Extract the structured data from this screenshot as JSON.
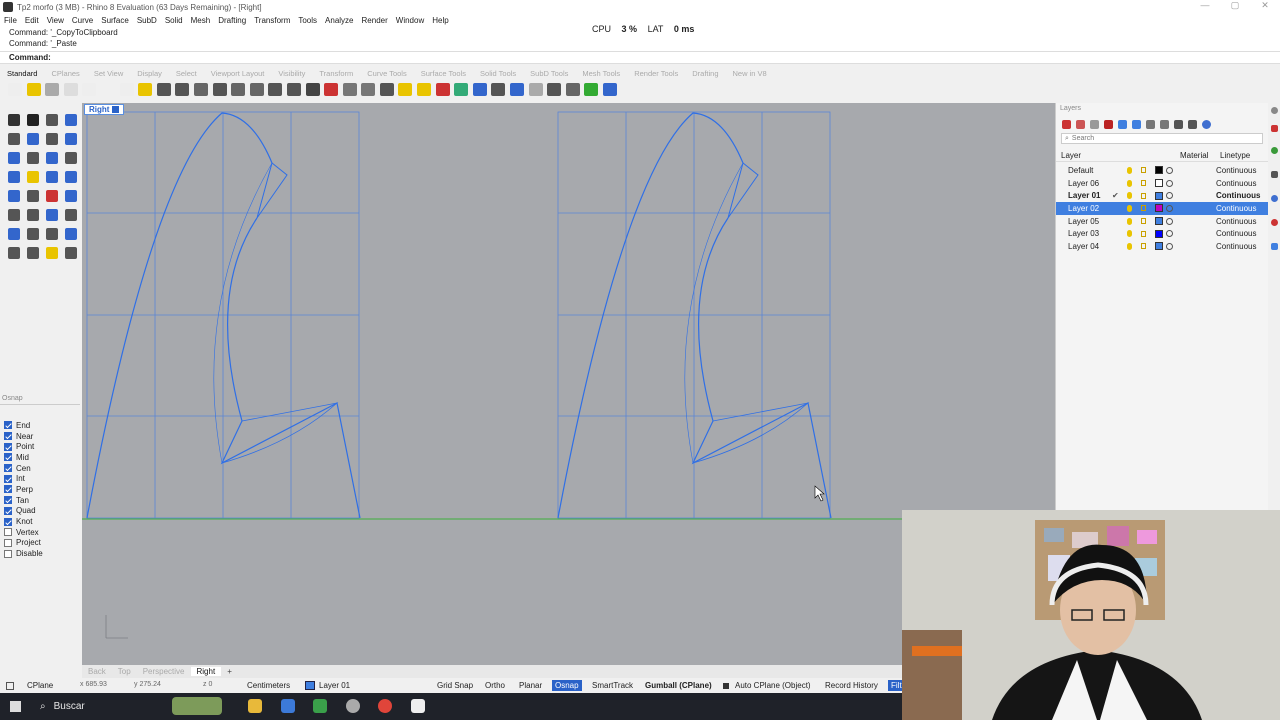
{
  "window": {
    "title": "Tp2 morfo (3 MB) - Rhino 8 Evaluation (63 Days Remaining) - [Right]"
  },
  "menu": [
    "File",
    "Edit",
    "View",
    "Curve",
    "Surface",
    "SubD",
    "Solid",
    "Mesh",
    "Drafting",
    "Transform",
    "Tools",
    "Analyze",
    "Render",
    "Window",
    "Help"
  ],
  "command_history": [
    "Command: '_CopyToClipboard",
    "Command: '_Paste"
  ],
  "perf": {
    "cpu_label": "CPU",
    "cpu": "3 %",
    "lat_label": "LAT",
    "lat": "0 ms"
  },
  "command_prompt": "Command:",
  "toolbar_tabs": [
    "Standard",
    "CPlanes",
    "Set View",
    "Display",
    "Select",
    "Viewport Layout",
    "Visibility",
    "Transform",
    "Curve Tools",
    "Surface Tools",
    "Solid Tools",
    "SubD Tools",
    "Mesh Tools",
    "Render Tools",
    "Drafting",
    "New in V8"
  ],
  "viewport": {
    "name": "Right"
  },
  "osnap": {
    "title": "Osnap",
    "items": [
      {
        "label": "End",
        "on": true
      },
      {
        "label": "Near",
        "on": true
      },
      {
        "label": "Point",
        "on": true
      },
      {
        "label": "Mid",
        "on": true
      },
      {
        "label": "Cen",
        "on": true
      },
      {
        "label": "Int",
        "on": true
      },
      {
        "label": "Perp",
        "on": true
      },
      {
        "label": "Tan",
        "on": true
      },
      {
        "label": "Quad",
        "on": true
      },
      {
        "label": "Knot",
        "on": true
      },
      {
        "label": "Vertex",
        "on": false
      },
      {
        "label": "Project",
        "on": false
      },
      {
        "label": "Disable",
        "on": false
      }
    ]
  },
  "layers": {
    "title": "Layers",
    "search_placeholder": "Search",
    "columns": {
      "layer": "Layer",
      "material": "Material",
      "linetype": "Linetype"
    },
    "rows": [
      {
        "name": "Default",
        "color": "#000000",
        "linetype": "Continuous",
        "current": false,
        "selected": false
      },
      {
        "name": "Layer 06",
        "color": "#ffffff",
        "linetype": "Continuous",
        "current": false,
        "selected": false
      },
      {
        "name": "Layer 01",
        "color": "#3f7fe0",
        "linetype": "Continuous",
        "current": true,
        "selected": false
      },
      {
        "name": "Layer 02",
        "color": "#c000c0",
        "linetype": "Continuous",
        "current": false,
        "selected": true
      },
      {
        "name": "Layer 05",
        "color": "#3f7fe0",
        "linetype": "Continuous",
        "current": false,
        "selected": false
      },
      {
        "name": "Layer 03",
        "color": "#0000ff",
        "linetype": "Continuous",
        "current": false,
        "selected": false
      },
      {
        "name": "Layer 04",
        "color": "#3f7fe0",
        "linetype": "Continuous",
        "current": false,
        "selected": false
      }
    ]
  },
  "viewport_tabs": [
    "Back",
    "Top",
    "Perspective",
    "Right"
  ],
  "status": {
    "cplane": "CPlane",
    "x": "x 685.93",
    "y": "y 275.24",
    "z": "z 0",
    "units": "Centimeters",
    "layer": "Layer 01",
    "grid_snap": "Grid Snap",
    "ortho": "Ortho",
    "planar": "Planar",
    "osnap": "Osnap",
    "smarttrack": "SmartTrack",
    "gumball": "Gumball (CPlane)",
    "auto_cplane": "Auto CPlane (Object)",
    "record_history": "Record History",
    "filter": "Filt"
  },
  "taskbar": {
    "search": "Buscar"
  },
  "colors": {
    "curve": "#2f6fe6",
    "grid": "#5b86d6",
    "viewport_bg": "#a7a9ad",
    "accent": "#2a62c8"
  }
}
